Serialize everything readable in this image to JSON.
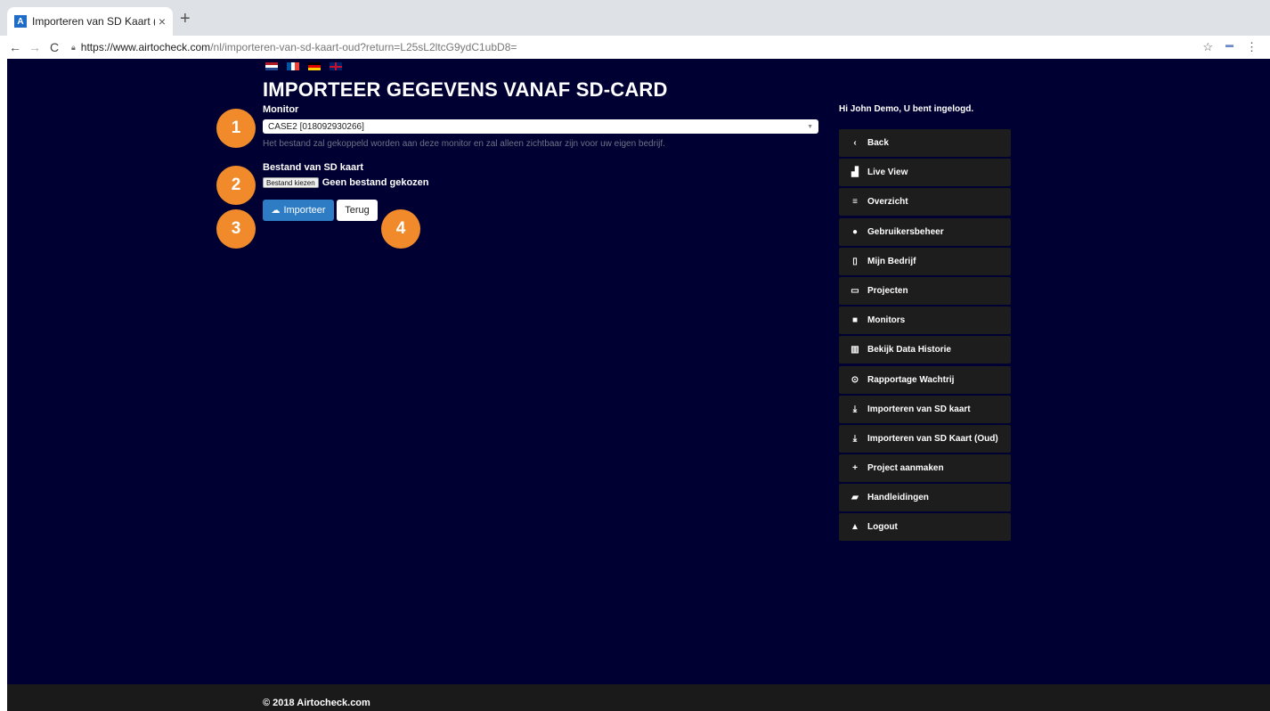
{
  "browser": {
    "tab_title": "Importeren van SD Kaart (Oud)",
    "tab_close": "×",
    "new_tab": "+",
    "url_host": "https://www.airtocheck.com",
    "url_path": "/nl/importeren-van-sd-kaart-oud?return=L25sL2ltcG9ydC1ubD8="
  },
  "page": {
    "title": "IMPORTEER GEGEVENS VANAF SD-CARD",
    "monitor_label": "Monitor",
    "monitor_selected": "CASE2 [018092930266]",
    "monitor_help": "Het bestand zal gekoppeld worden aan deze monitor en zal alleen zichtbaar zijn voor uw eigen bedrijf.",
    "file_label": "Bestand van SD kaart",
    "file_button": "Bestand kiezen",
    "file_status": "Geen bestand gekozen",
    "import_button": "Importeer",
    "back_button": "Terug"
  },
  "markers": [
    "1",
    "2",
    "3",
    "4"
  ],
  "sidebar": {
    "greeting": "Hi John Demo, U bent ingelogd.",
    "items": [
      {
        "label": "Back",
        "icon": "‹"
      },
      {
        "label": "Live View",
        "icon": "▟"
      },
      {
        "label": "Overzicht",
        "icon": "≡"
      },
      {
        "label": "Gebruikersbeheer",
        "icon": "●"
      },
      {
        "label": "Mijn Bedrijf",
        "icon": "▯"
      },
      {
        "label": "Projecten",
        "icon": "▭"
      },
      {
        "label": "Monitors",
        "icon": "■"
      },
      {
        "label": "Bekijk Data Historie",
        "icon": "▥"
      },
      {
        "label": "Rapportage Wachtrij",
        "icon": "⊙"
      },
      {
        "label": "Importeren van SD kaart",
        "icon": "⤓"
      },
      {
        "label": "Importeren van SD Kaart (Oud)",
        "icon": "⤓"
      },
      {
        "label": "Project aanmaken",
        "icon": "+"
      },
      {
        "label": "Handleidingen",
        "icon": "▰"
      },
      {
        "label": "Logout",
        "icon": "▲"
      }
    ]
  },
  "footer": {
    "text": "© 2018 Airtocheck.com"
  },
  "colors": {
    "page_bg": "#000033",
    "accent_blue": "#2d7cc4",
    "marker_orange": "#f08a2a",
    "sidebar_item": "#1d1d1d"
  }
}
